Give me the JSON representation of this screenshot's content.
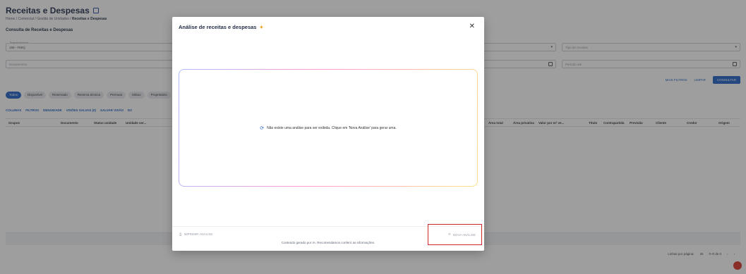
{
  "page": {
    "title": "Receitas e Despesas",
    "breadcrumb": [
      "Home",
      "Comercial",
      "Gestão de Unidades",
      "Receitas e Despesas"
    ],
    "section_title": "Consulta de Receitas e Despesas",
    "empreendimento_label": "Empreendimento",
    "empreendimento_value": "199 - FMIQ",
    "tipo_receita_placeholder": "Tipo de receitas",
    "documento_placeholder": "Documentos",
    "periodo_placeholder": "Período até",
    "mais_filtros": "MAIS FILTROS",
    "limpar": "LIMPAR",
    "consultar": "CONSULTAR",
    "chips": [
      "Todos",
      "Disponível",
      "Reservado",
      "Reserva técnica",
      "Permuta",
      "Mútuo",
      "Proprietário"
    ],
    "toolbar": [
      "COLUNAS",
      "FILTROS",
      "DENSIDADE",
      "VISÕES SALVAS (0)",
      "SALVAR VISÃO",
      "EX"
    ],
    "columns_left": [
      "Grupos",
      "Documento",
      "Status unidade",
      "Unidade ser..."
    ],
    "columns_right": [
      "Área total",
      "Área privativa",
      "Valor por m² ve...",
      "Título",
      "Contrapartida",
      "Previsão",
      "Cliente",
      "Credor",
      "Origem"
    ],
    "rows_per_page_label": "Linhas por página:",
    "rows_per_page": "25",
    "range": "0–0 de 0"
  },
  "modal": {
    "title": "Análise de receitas e despesas",
    "empty_message": "Não existe uma análise para ser exibida. Clique em 'Nova Análise' para gerar uma.",
    "print_label": "IMPRIMIR ANÁLISE",
    "new_label": "NOVA ANÁLISE",
    "footnote": "Conteúdo gerado por IA. Recomendamos conferir as informações."
  },
  "icons": {
    "sparkle": "sparkle-icon",
    "close": "close-icon",
    "refresh": "refresh-icon"
  },
  "colors": {
    "primary": "#1f62c5",
    "highlight": "#d1262b"
  }
}
